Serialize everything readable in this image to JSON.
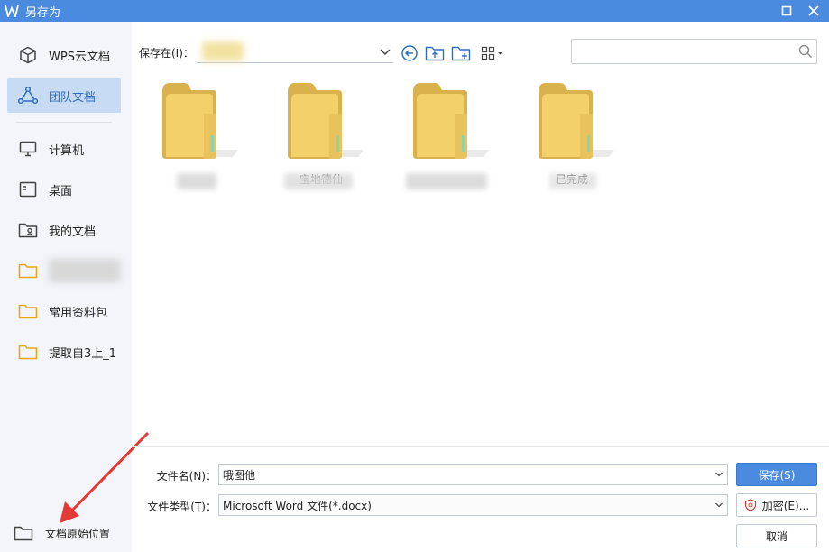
{
  "window": {
    "title": "另存为"
  },
  "sidebar": {
    "items": [
      {
        "label": "WPS云文档",
        "icon": "cube-icon"
      },
      {
        "label": "团队文档",
        "icon": "team-icon",
        "active": true
      },
      {
        "label": "计算机",
        "icon": "monitor-icon"
      },
      {
        "label": "桌面",
        "icon": "desktop-icon"
      },
      {
        "label": "我的文档",
        "icon": "user-folder-icon"
      },
      {
        "label": "",
        "icon": "folder-icon"
      },
      {
        "label": "常用资料包",
        "icon": "folder-icon"
      },
      {
        "label": "提取自3上_1",
        "icon": "folder-icon"
      }
    ],
    "original_location_label": "文档原始位置"
  },
  "toolbar": {
    "save_in_label": "保存在(I)：",
    "path_value": "",
    "search_placeholder": ""
  },
  "files": [
    {
      "name": ""
    },
    {
      "name": "宝地德仙"
    },
    {
      "name": ""
    },
    {
      "name": "已完成"
    }
  ],
  "form": {
    "filename_label": "文件名(N)：",
    "filename_value": "哦图他",
    "filetype_label": "文件类型(T)：",
    "filetype_value": "Microsoft Word 文件(*.docx)",
    "save_button": "保存(S)",
    "encrypt_button": "加密(E)...",
    "cancel_button": "取消"
  },
  "colors": {
    "accent": "#4a8be0",
    "active_bg": "#c7dbf4",
    "folder_yellow": "#f4d06a",
    "annotation_red": "#e53935"
  }
}
